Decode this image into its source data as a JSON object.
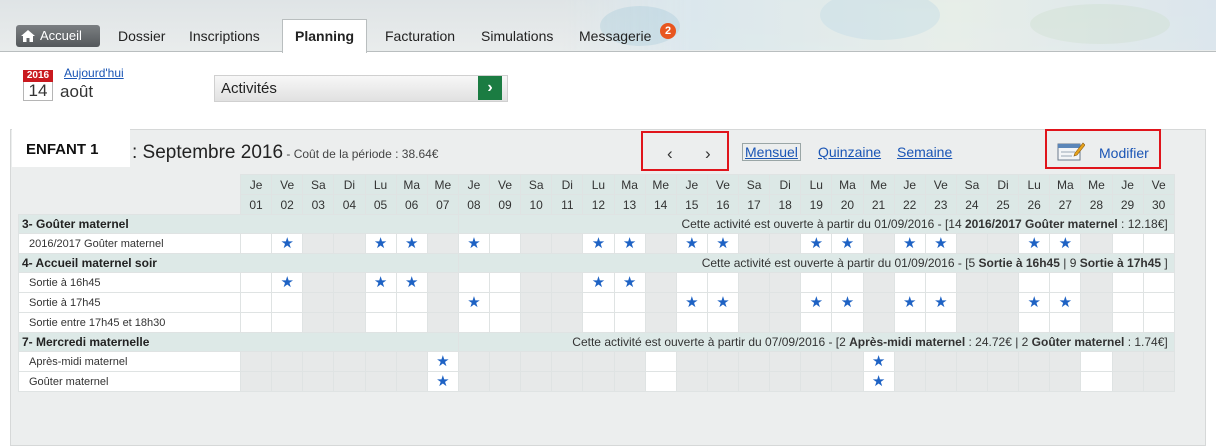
{
  "nav": {
    "home_label": "Accueil",
    "tabs": [
      "Dossier",
      "Inscriptions",
      "Planning",
      "Facturation",
      "Simulations",
      "Messagerie"
    ],
    "active_tab": "Planning",
    "messages_badge": "2"
  },
  "date": {
    "year": "2016",
    "today_link": "Aujourd'hui",
    "day": "14",
    "month": "août"
  },
  "activity_selector": {
    "label": "Activités",
    "go_icon": "chevron-right-icon"
  },
  "period": {
    "child": "ENFANT 1",
    "title": ": Septembre 2016",
    "cost": " - Coût de la période : 38.64€",
    "prev_icon": "chevron-left-icon",
    "next_icon": "chevron-right-icon",
    "views": [
      "Mensuel",
      "Quinzaine",
      "Semaine"
    ],
    "active_view": "Mensuel",
    "modify_label": "Modifier"
  },
  "calendar": {
    "day_names": [
      "Je",
      "Ve",
      "Sa",
      "Di",
      "Lu",
      "Ma",
      "Me",
      "Je",
      "Ve",
      "Sa",
      "Di",
      "Lu",
      "Ma",
      "Me",
      "Je",
      "Ve",
      "Sa",
      "Di",
      "Lu",
      "Ma",
      "Me",
      "Je",
      "Ve",
      "Sa",
      "Di",
      "Lu",
      "Ma",
      "Me",
      "Je",
      "Ve"
    ],
    "day_numbers": [
      "01",
      "02",
      "03",
      "04",
      "05",
      "06",
      "07",
      "08",
      "09",
      "10",
      "11",
      "12",
      "13",
      "14",
      "15",
      "16",
      "17",
      "18",
      "19",
      "20",
      "21",
      "22",
      "23",
      "24",
      "25",
      "26",
      "27",
      "28",
      "29",
      "30"
    ]
  },
  "sections": [
    {
      "name": "3- Goûter maternel",
      "info": "Cette activité est ouverte à partir du 01/09/2016 - [14 <b>2016/2017 Goûter maternel</b> : 12.18€]",
      "rows": [
        {
          "label": "2016/2017 Goûter maternel",
          "off_days": [
            3,
            4,
            7,
            10,
            11,
            14,
            17,
            18,
            21,
            24,
            25,
            28
          ],
          "star_days": [
            2,
            5,
            6,
            8,
            12,
            13,
            15,
            16,
            19,
            20,
            22,
            23,
            26,
            27
          ]
        }
      ]
    },
    {
      "name": "4- Accueil maternel soir",
      "info": "Cette activité est ouverte à partir du 01/09/2016 - [5 <b>Sortie à 16h45</b> | 9 <b>Sortie à 17h45</b> ]",
      "rows": [
        {
          "label": "Sortie à 16h45",
          "off_days": [
            3,
            4,
            7,
            10,
            11,
            14,
            17,
            18,
            21,
            24,
            25,
            28
          ],
          "star_days": [
            2,
            5,
            6,
            12,
            13
          ]
        },
        {
          "label": "Sortie à 17h45",
          "off_days": [
            3,
            4,
            7,
            10,
            11,
            14,
            17,
            18,
            21,
            24,
            25,
            28
          ],
          "star_days": [
            8,
            15,
            16,
            19,
            20,
            22,
            23,
            26,
            27
          ]
        },
        {
          "label": "Sortie entre 17h45 et 18h30",
          "off_days": [
            3,
            4,
            7,
            10,
            11,
            14,
            17,
            18,
            21,
            24,
            25,
            28
          ],
          "star_days": []
        }
      ]
    },
    {
      "name": "7- Mercredi maternelle",
      "info": "Cette activité est ouverte à partir du 07/09/2016 - [2 <b>Après-midi maternel</b> : 24.72€ | 2 <b>Goûter maternel</b> : 1.74€]",
      "rows": [
        {
          "label": "Après-midi maternel",
          "off_days": [
            1,
            2,
            3,
            4,
            5,
            6,
            8,
            9,
            10,
            11,
            12,
            13,
            15,
            16,
            17,
            18,
            19,
            20,
            22,
            23,
            24,
            25,
            26,
            27,
            29,
            30
          ],
          "star_days": [
            7,
            21
          ]
        },
        {
          "label": "Goûter maternel",
          "off_days": [
            1,
            2,
            3,
            4,
            5,
            6,
            8,
            9,
            10,
            11,
            12,
            13,
            15,
            16,
            17,
            18,
            19,
            20,
            22,
            23,
            24,
            25,
            26,
            27,
            29,
            30
          ],
          "star_days": [
            7,
            21
          ]
        }
      ]
    }
  ],
  "colors": {
    "accent_blue": "#1a55b5",
    "star": "#1e62c4",
    "highlight_red": "#e0141b",
    "go_green": "#1b7c42",
    "badge_orange": "#e8561f",
    "year_red": "#c9191f"
  }
}
